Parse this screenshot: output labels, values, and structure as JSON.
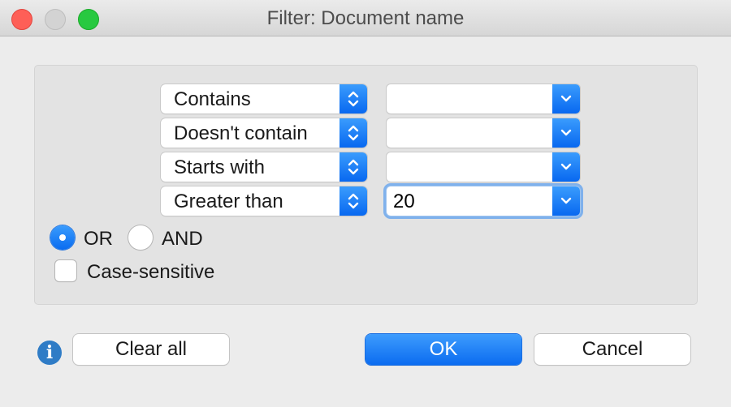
{
  "window": {
    "title": "Filter: Document name"
  },
  "conditions": [
    {
      "operator": "Contains",
      "value": ""
    },
    {
      "operator": "Doesn't contain",
      "value": ""
    },
    {
      "operator": "Starts with",
      "value": ""
    },
    {
      "operator": "Greater than",
      "value": "20"
    }
  ],
  "logic": {
    "or_label": "OR",
    "and_label": "AND",
    "selected": "OR"
  },
  "options": {
    "case_sensitive_label": "Case-sensitive",
    "case_sensitive_checked": false
  },
  "buttons": {
    "clear_all": "Clear all",
    "ok": "OK",
    "cancel": "Cancel"
  },
  "icons": {
    "info": "info-icon",
    "operator_arrows": "up-down-chevron-icon",
    "value_arrow": "chevron-down-icon"
  },
  "colors": {
    "accent": "#0a6cf0",
    "close": "#fe5f57",
    "maximize": "#28c940"
  }
}
